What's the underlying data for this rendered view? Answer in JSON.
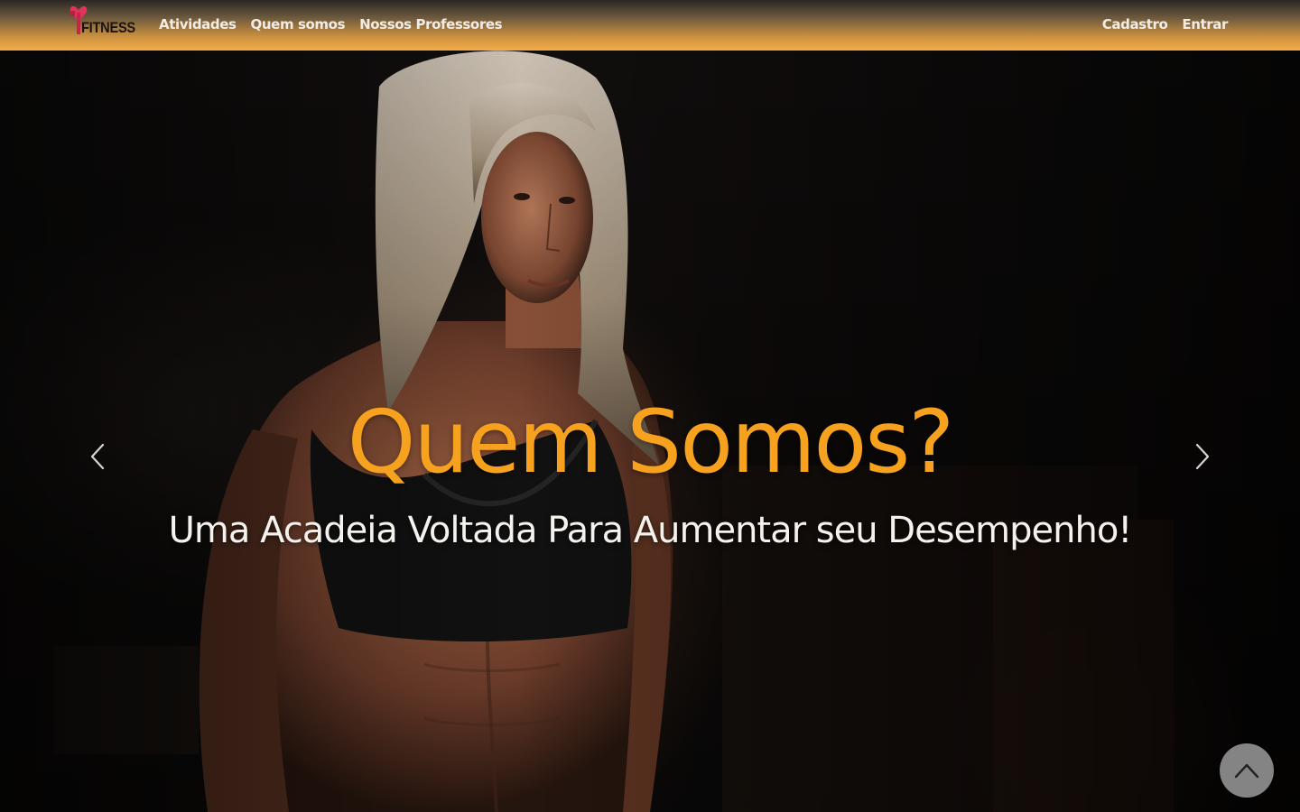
{
  "navbar": {
    "brand_text": "FITNESS",
    "brand_icon": "heart-dumbbell-logo-icon",
    "links_left": [
      {
        "label": "Atividades"
      },
      {
        "label": "Quem somos"
      },
      {
        "label": "Nossos Professores"
      }
    ],
    "links_right": [
      {
        "label": "Cadastro"
      },
      {
        "label": "Entrar"
      }
    ]
  },
  "carousel": {
    "title": "Quem Somos?",
    "subtitle": "Uma Acadeia Voltada Para Aumentar seu Desempenho!",
    "prev_icon": "chevron-left-icon",
    "next_icon": "chevron-right-icon"
  },
  "back_to_top": {
    "icon": "chevron-up-icon"
  },
  "colors": {
    "accent": "#f7a21e",
    "navbar_bottom": "#f6ad46",
    "navbar_top": "#2a2724",
    "logo_pink": "#e0345c",
    "text_light": "#f5f2ee"
  }
}
